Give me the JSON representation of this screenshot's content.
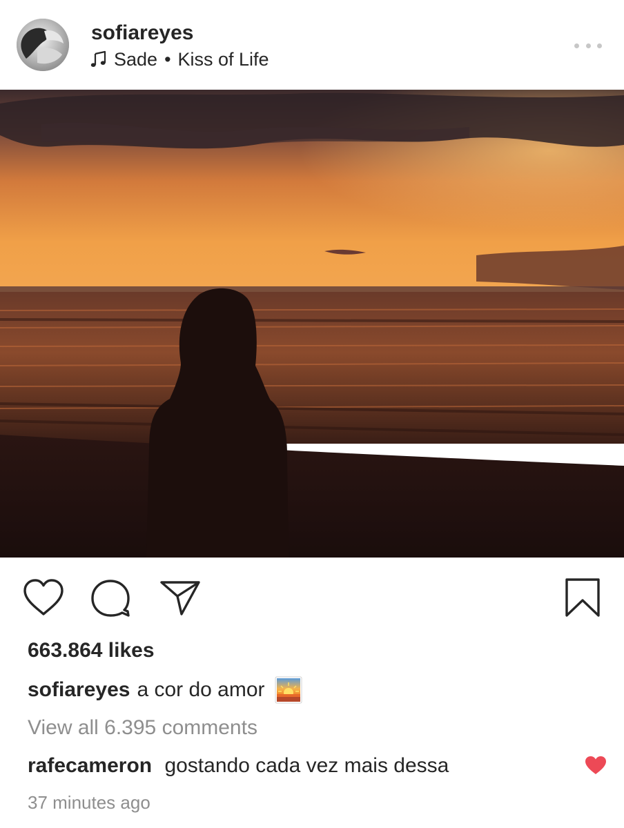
{
  "post": {
    "username": "sofiareyes",
    "music": {
      "artist": "Sade",
      "separator": "•",
      "song": "Kiss of Life"
    },
    "photo_alt": "",
    "likes": "663.864 likes",
    "caption": {
      "username": "sofiareyes",
      "text": "a cor do amor"
    },
    "view_all_comments": "View all 6.395 comments",
    "comment": {
      "username": "rafecameron",
      "text": "gostando cada vez mais dessa",
      "liked": true
    },
    "timestamp": "37 minutes ago"
  },
  "icons": {
    "more": "more-options-icon",
    "music": "music-note-icon",
    "like": "heart-icon",
    "comment": "comment-bubble-icon",
    "share": "paper-plane-icon",
    "save": "bookmark-icon",
    "caption_emoji": "sunrise-emoji-icon",
    "comment_like": "heart-filled-icon"
  },
  "colors": {
    "text": "#262626",
    "muted": "#8e8e8e",
    "like_red": "#ed4956",
    "dots": "#c7c7c7"
  }
}
